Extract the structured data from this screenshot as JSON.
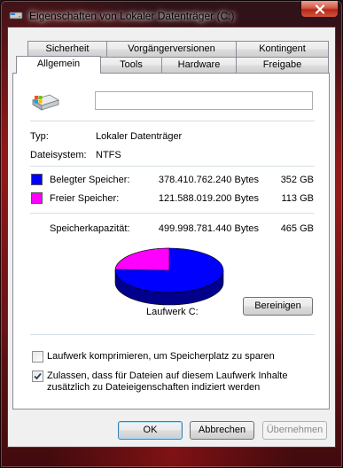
{
  "window": {
    "title": "Eigenschaften von Lokaler Datenträger (C:)"
  },
  "tabs": {
    "row1": [
      "Sicherheit",
      "Vorgängerversionen",
      "Kontingent"
    ],
    "row2": [
      "Allgemein",
      "Tools",
      "Hardware",
      "Freigabe"
    ],
    "active": "Allgemein"
  },
  "general": {
    "name_value": "",
    "type_label": "Typ:",
    "type_value": "Lokaler Datenträger",
    "fs_label": "Dateisystem:",
    "fs_value": "NTFS",
    "used_label": "Belegter Speicher:",
    "used_bytes": "378.410.762.240 Bytes",
    "used_gb": "352 GB",
    "free_label": "Freier Speicher:",
    "free_bytes": "121.588.019.200 Bytes",
    "free_gb": "113 GB",
    "capacity_label": "Speicherkapazität:",
    "capacity_bytes": "499.998.781.440 Bytes",
    "capacity_gb": "465 GB",
    "drive_label": "Laufwerk C:",
    "cleanup_button": "Bereinigen",
    "compress_label": "Laufwerk komprimieren, um Speicherplatz zu sparen",
    "compress_checked": false,
    "index_label_line1": "Zulassen, dass für Dateien auf diesem Laufwerk Inhalte",
    "index_label_line2": "zusätzlich zu Dateieigenschaften indiziert werden",
    "index_checked": true
  },
  "chart_data": {
    "type": "pie",
    "categories": [
      "Belegter Speicher",
      "Freier Speicher"
    ],
    "values": [
      352,
      113
    ],
    "colors": [
      "#0000ff",
      "#ff00ff"
    ]
  },
  "buttons": {
    "ok": "OK",
    "cancel": "Abbrechen",
    "apply": "Übernehmen"
  },
  "colors": {
    "used": "#0000ff",
    "free": "#ff00ff"
  }
}
